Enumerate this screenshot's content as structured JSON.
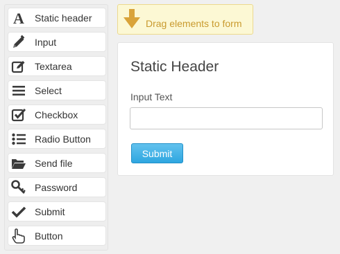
{
  "palette": {
    "items": [
      {
        "label": "Static header",
        "icon": "letter-a-icon"
      },
      {
        "label": "Input",
        "icon": "pencil-icon"
      },
      {
        "label": "Textarea",
        "icon": "edit-box-icon"
      },
      {
        "label": "Select",
        "icon": "hamburger-list-icon"
      },
      {
        "label": "Checkbox",
        "icon": "checked-box-icon"
      },
      {
        "label": "Radio Button",
        "icon": "bullet-list-icon"
      },
      {
        "label": "Send file",
        "icon": "folder-open-icon"
      },
      {
        "label": "Password",
        "icon": "key-icon"
      },
      {
        "label": "Submit",
        "icon": "check-mark-icon"
      },
      {
        "label": "Button",
        "icon": "pointing-hand-icon"
      }
    ]
  },
  "drop_hint": {
    "text": "Drag elements to form",
    "icon": "arrow-down-icon",
    "color": "#d9a33a"
  },
  "form": {
    "title": "Static Header",
    "input_label": "Input Text",
    "input_value": "",
    "submit_label": "Submit"
  },
  "colors": {
    "accent": "#2ea6e0",
    "hint_bg": "#fcf8d4",
    "hint_text": "#c99a2e"
  }
}
